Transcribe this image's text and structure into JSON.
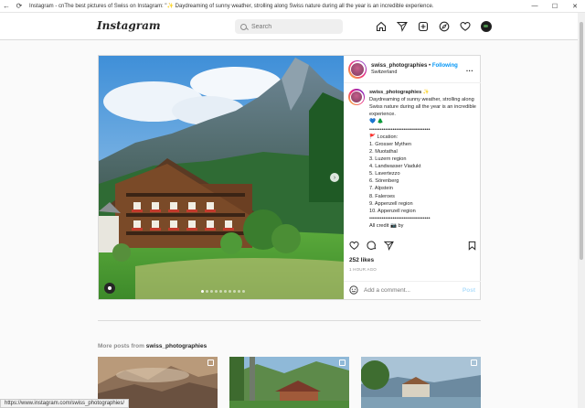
{
  "browser": {
    "title": "Instagram - cnThe best pictures of Swiss on Instagram: \"✨ Daydreaming of sunny weather, strolling along Swiss nature during all the year is an incredible experience.",
    "status_url": "https://www.instagram.com/swiss_photographies/"
  },
  "nav": {
    "logo": "Instagram",
    "search_placeholder": "Search",
    "icons": [
      "home-icon",
      "send-icon",
      "new-post-icon",
      "explore-icon",
      "heart-icon",
      "profile-avatar"
    ]
  },
  "post": {
    "username": "swiss_photographies",
    "separator": "•",
    "follow_label": "Following",
    "location": "Switzerland",
    "more": "...",
    "caption": {
      "username": "swiss_photographies",
      "sparkle": "✨",
      "text": "Daydreaming of sunny weather, strolling along Swiss nature during all the year is an incredible experience.",
      "emojis": "💙 🌲",
      "rule1": "••••••••••••••••••••••••••••••••••",
      "location_header": "🚩 Location:",
      "locations": [
        "1. Grosser Mythen",
        "2. Muotathal",
        "3. Luzern region",
        "4. Landwasser Viadukt",
        "5. Lavertezzo",
        "6. Sörenberg",
        "7. Alpstein",
        "8. Faleroes",
        "9. Appenzell region",
        "10. Appenzell region"
      ],
      "rule2": "••••••••••••••••••••••••••••••••••",
      "credit": "All credit 📷 by"
    },
    "likes": "252 likes",
    "time_ago": "1 HOUR AGO",
    "comment_placeholder": "Add a comment...",
    "post_label": "Post"
  },
  "more_posts": {
    "prefix": "More posts from",
    "username": "swiss_photographies"
  },
  "colors": {
    "link_blue": "#0095f6",
    "post_disabled": "#b2dffc",
    "border": "#dbdbdb"
  }
}
